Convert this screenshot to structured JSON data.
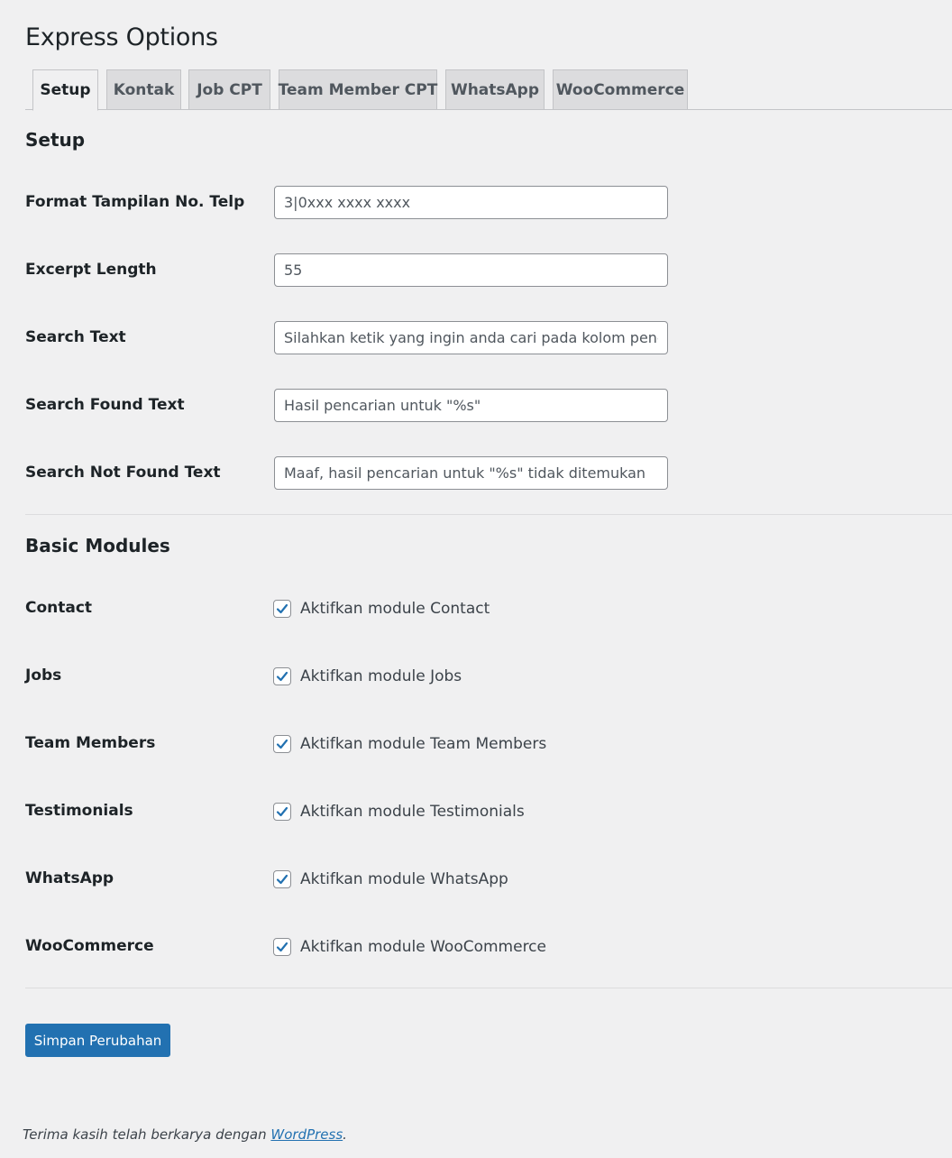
{
  "page_title": "Express Options",
  "tabs": [
    {
      "label": "Setup",
      "active": true
    },
    {
      "label": "Kontak",
      "active": false
    },
    {
      "label": "Job CPT",
      "active": false
    },
    {
      "label": "Team Member CPT",
      "active": false
    },
    {
      "label": "WhatsApp",
      "active": false
    },
    {
      "label": "WooCommerce",
      "active": false
    }
  ],
  "setup": {
    "title": "Setup",
    "fields": [
      {
        "label": "Format Tampilan No. Telp",
        "value": "3|0xxx xxxx xxxx"
      },
      {
        "label": "Excerpt Length",
        "value": "55"
      },
      {
        "label": "Search Text",
        "value": "Silahkan ketik yang ingin anda cari pada kolom penca"
      },
      {
        "label": "Search Found Text",
        "value": "Hasil pencarian untuk \"%s\""
      },
      {
        "label": "Search Not Found Text",
        "value": "Maaf, hasil pencarian untuk \"%s\" tidak ditemukan"
      }
    ]
  },
  "modules": {
    "title": "Basic Modules",
    "items": [
      {
        "label": "Contact",
        "checkbox_label": "Aktifkan module Contact",
        "checked": true
      },
      {
        "label": "Jobs",
        "checkbox_label": "Aktifkan module Jobs",
        "checked": true
      },
      {
        "label": "Team Members",
        "checkbox_label": "Aktifkan module Team Members",
        "checked": true
      },
      {
        "label": "Testimonials",
        "checkbox_label": "Aktifkan module Testimonials",
        "checked": true
      },
      {
        "label": "WhatsApp",
        "checkbox_label": "Aktifkan module WhatsApp",
        "checked": true
      },
      {
        "label": "WooCommerce",
        "checkbox_label": "Aktifkan module WooCommerce",
        "checked": true
      }
    ]
  },
  "save_button": "Simpan Perubahan",
  "footer": {
    "text": "Terima kasih telah berkarya dengan ",
    "link": "WordPress",
    "suffix": "."
  },
  "colors": {
    "accent": "#2271b1",
    "background": "#f0f0f1"
  }
}
